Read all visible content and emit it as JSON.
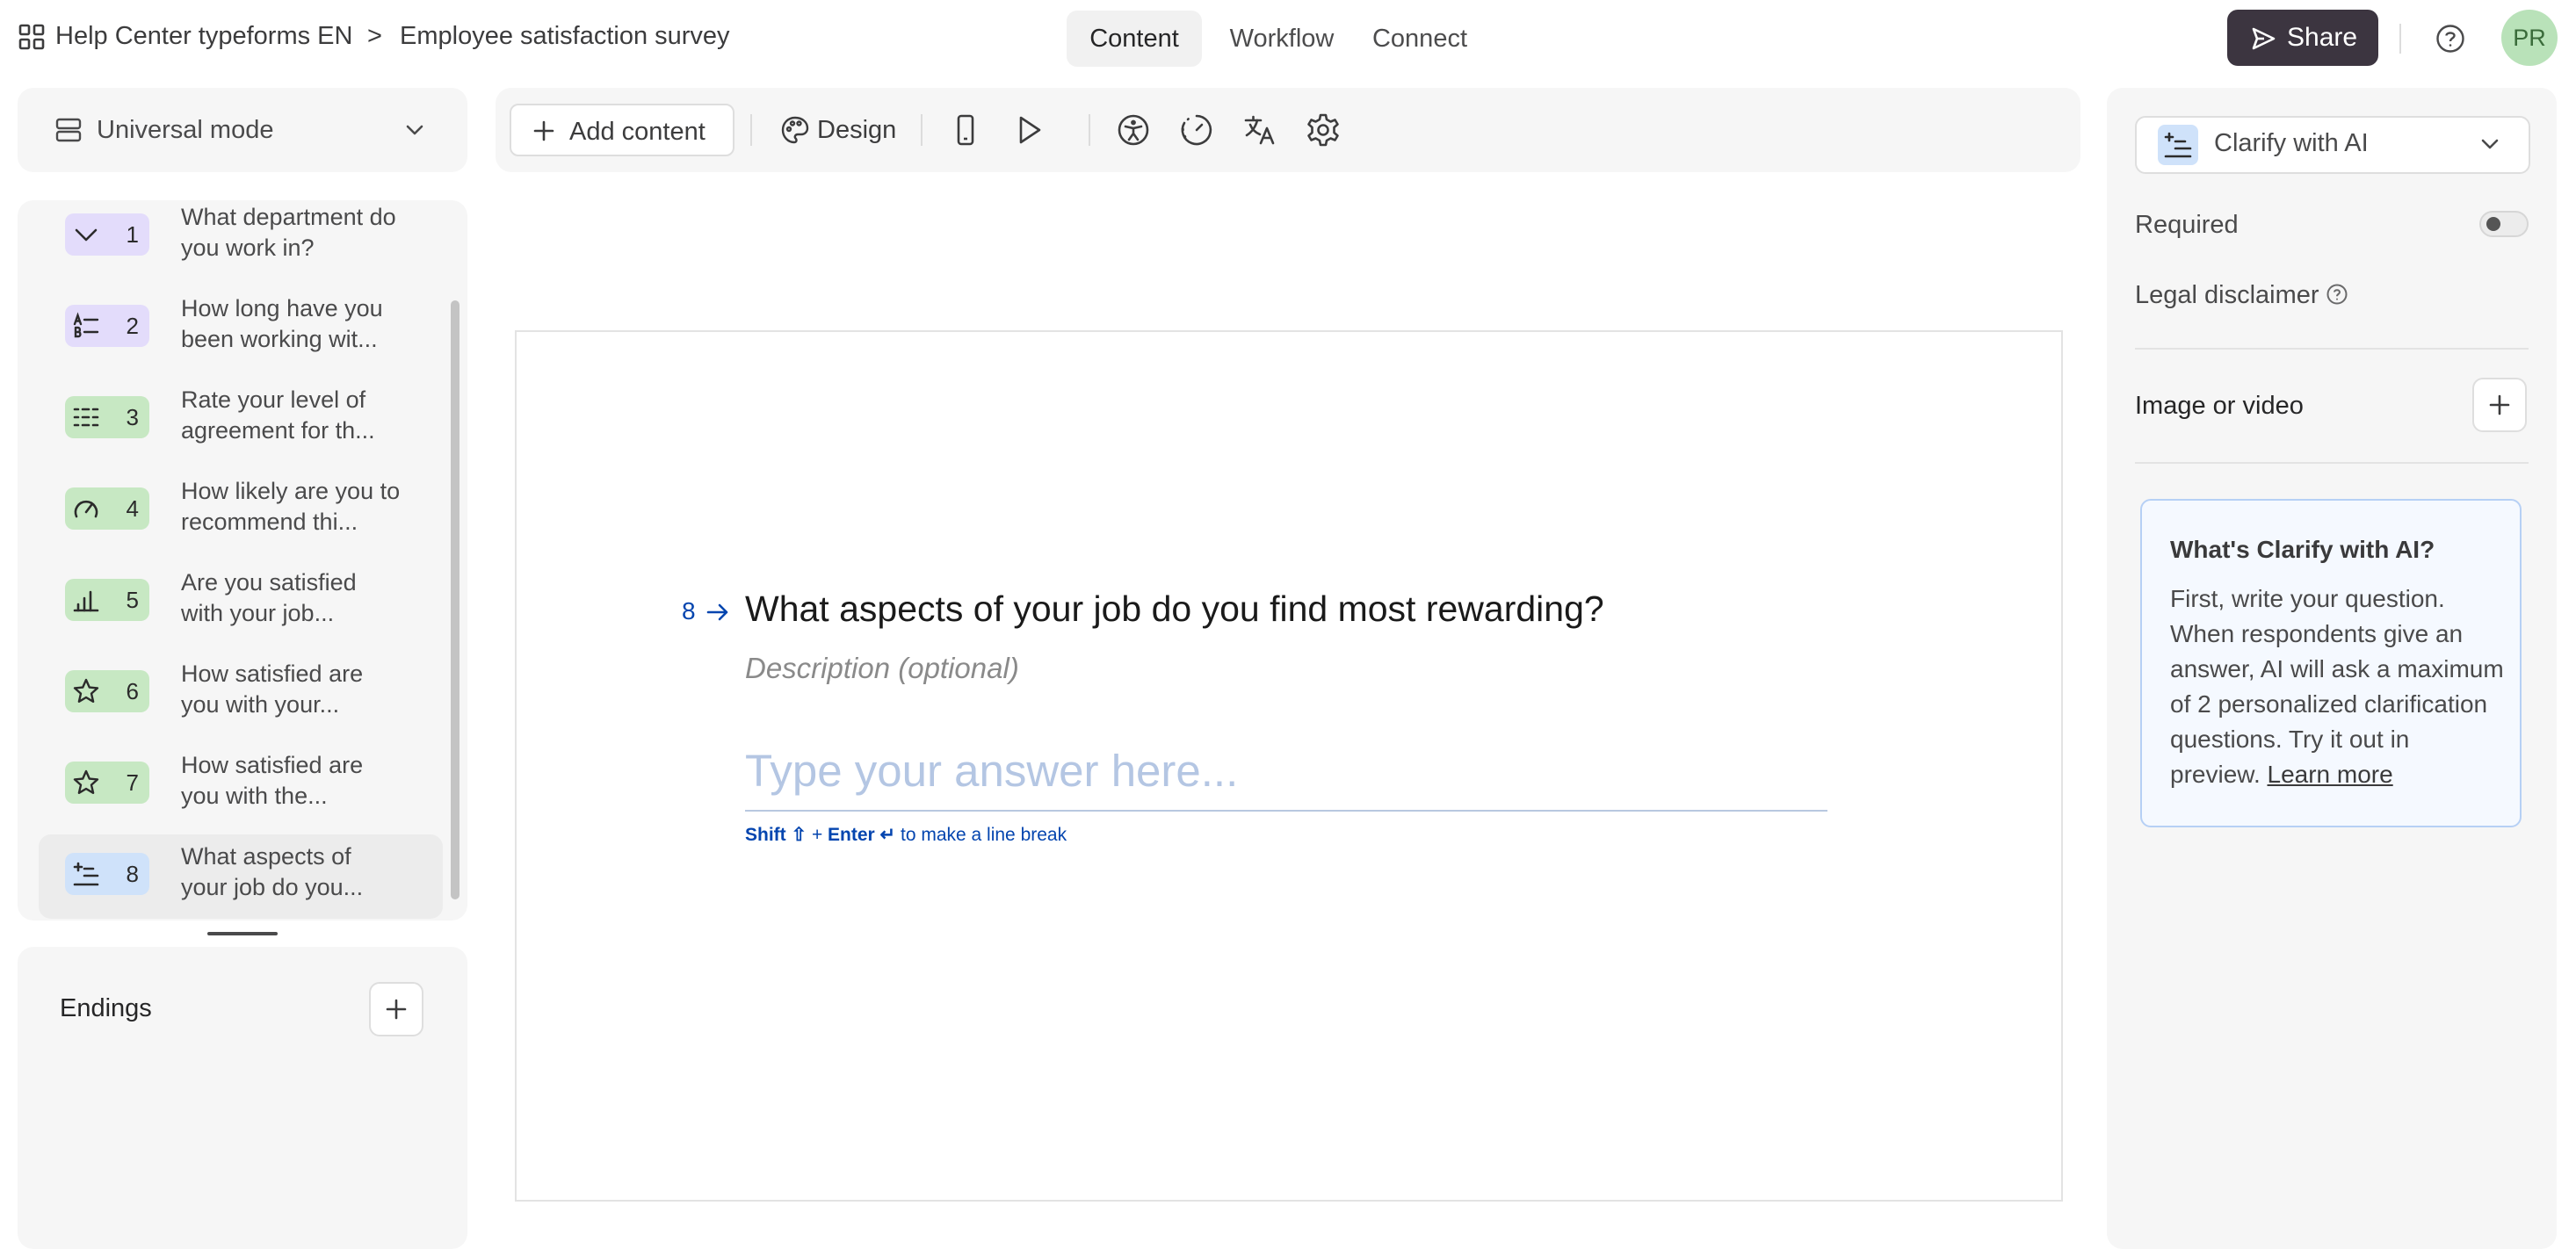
{
  "breadcrumb": {
    "workspace": "Help Center typeforms EN",
    "separator": ">",
    "form": "Employee satisfaction survey"
  },
  "tabs": [
    {
      "label": "Content",
      "active": true
    },
    {
      "label": "Workflow",
      "active": false
    },
    {
      "label": "Connect",
      "active": false
    }
  ],
  "share_label": "Share",
  "avatar_initials": "PR",
  "mode": {
    "label": "Universal mode"
  },
  "questions": [
    {
      "number": "1",
      "text": "What department do you work in?",
      "icon": "dropdown-icon",
      "badge_color": "#e3dcfb"
    },
    {
      "number": "2",
      "text": "How long have you been working wit...",
      "icon": "multiple-choice-icon",
      "badge_color": "#e3dcfb"
    },
    {
      "number": "3",
      "text": "Rate your level of agreement for th...",
      "icon": "matrix-icon",
      "badge_color": "#c7e8c3"
    },
    {
      "number": "4",
      "text": "How likely are you to recommend thi...",
      "icon": "gauge-icon",
      "badge_color": "#c7e8c3"
    },
    {
      "number": "5",
      "text": "Are you satisfied with your job...",
      "icon": "opinion-scale-icon",
      "badge_color": "#c7e8c3"
    },
    {
      "number": "6",
      "text": "How satisfied are you with your...",
      "icon": "star-icon",
      "badge_color": "#c7e8c3"
    },
    {
      "number": "7",
      "text": "How satisfied are you with the...",
      "icon": "star-icon",
      "badge_color": "#c7e8c3"
    },
    {
      "number": "8",
      "text": "What aspects of your job do you...",
      "icon": "clarify-ai-icon",
      "badge_color": "#cfe2fa",
      "selected": true
    }
  ],
  "endings": {
    "label": "Endings"
  },
  "toolbar": {
    "add_content": "Add content",
    "design": "Design"
  },
  "question": {
    "number": "8",
    "title": "What aspects of your job do you find most rewarding?",
    "description_placeholder": "Description (optional)",
    "answer_placeholder": "Type your answer here...",
    "hint": {
      "shift": "Shift ⇧",
      "plus": "+",
      "enter": "Enter ↵",
      "rest": "to make a line break"
    }
  },
  "settings": {
    "question_type": "Clarify with AI",
    "required_label": "Required",
    "required_on": false,
    "legal_label": "Legal disclaimer",
    "image_label": "Image or video"
  },
  "info": {
    "title": "What's Clarify with AI?",
    "body": "First, write your question. When respondents give an answer, AI will ask a maximum of 2 personalized clarification questions. Try it out in preview.",
    "link": "Learn more"
  },
  "colors": {
    "accent_blue": "#0445af",
    "share_bg": "#3c3540",
    "avatar_bg": "#b9e2b9",
    "info_border": "#b6d0f5"
  }
}
